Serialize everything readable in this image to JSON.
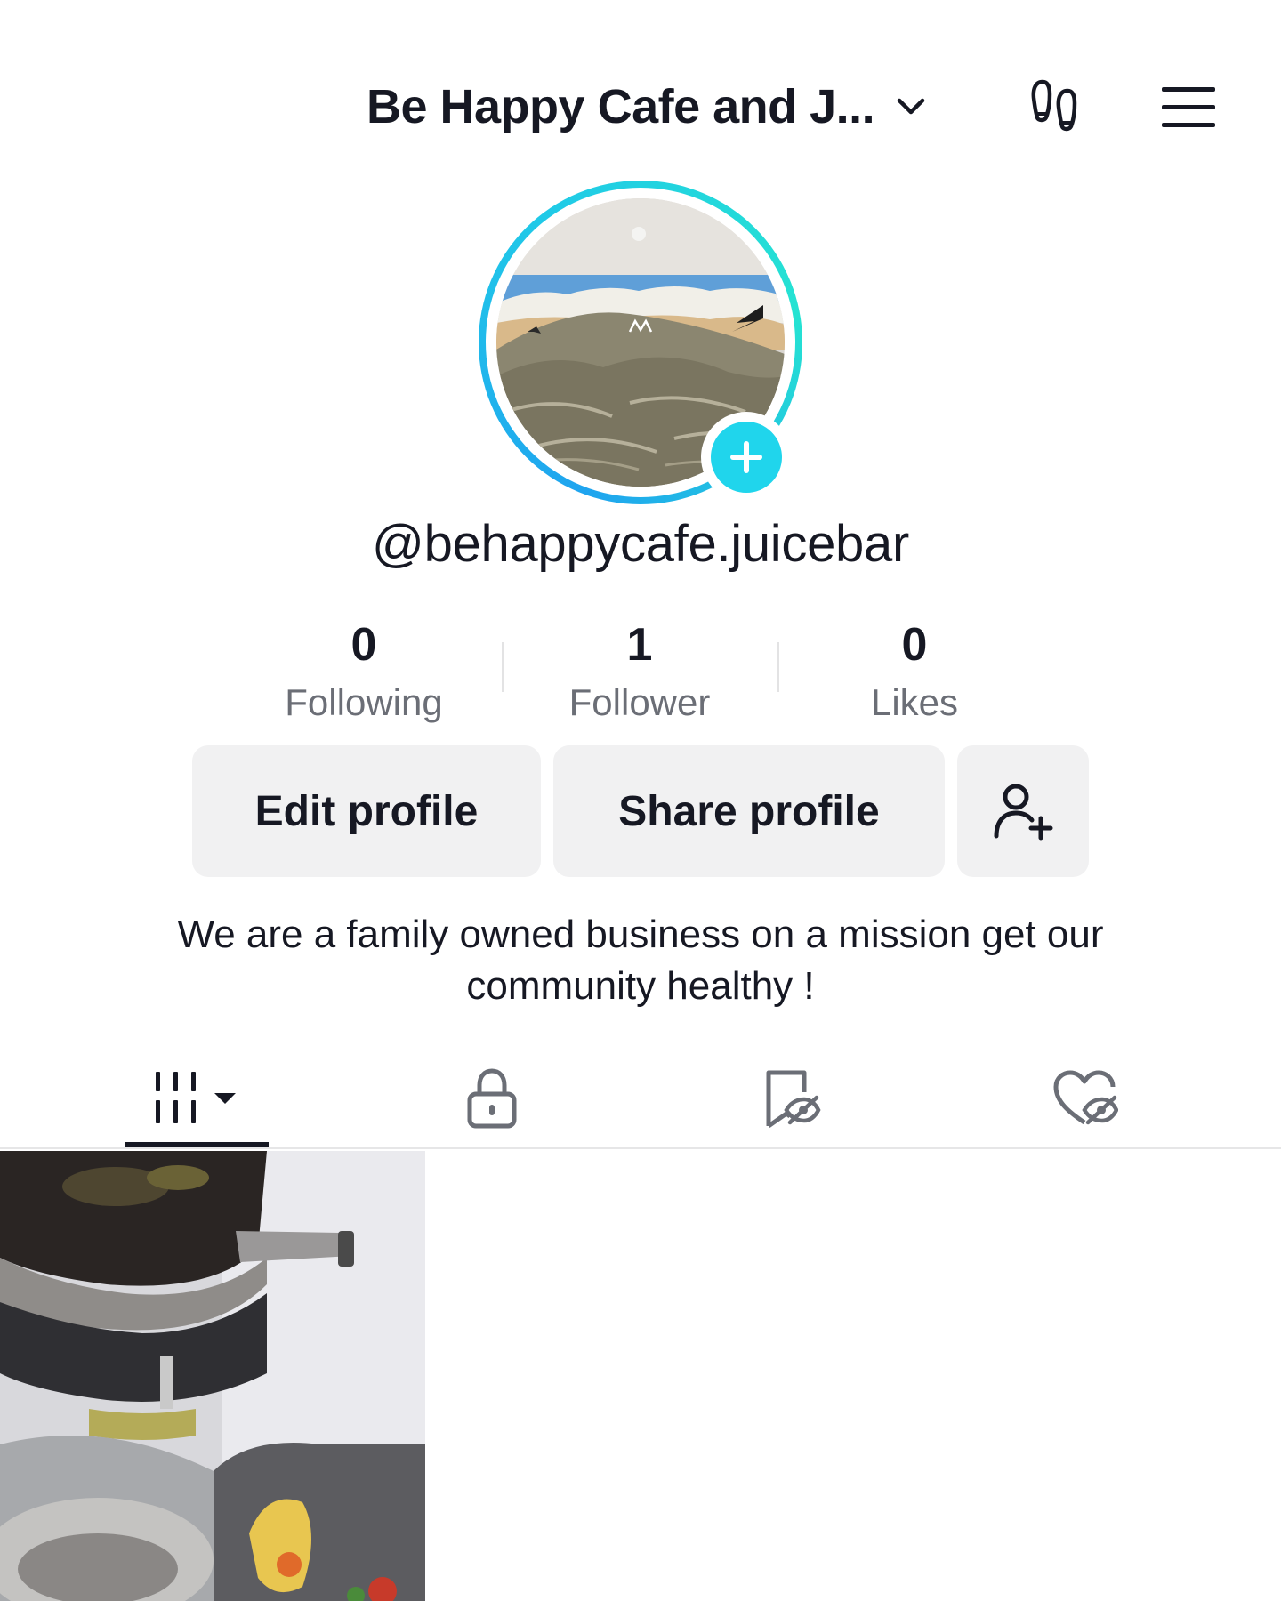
{
  "header": {
    "account_name": "Be Happy Cafe and J...",
    "icons": {
      "switch": "chevron-down-icon",
      "footprint": "footprint-icon",
      "menu": "hamburger-menu-icon"
    }
  },
  "profile": {
    "username": "@behappycafe.juicebar",
    "avatar_icon": "plus-icon",
    "stats": [
      {
        "value": "0",
        "label": "Following"
      },
      {
        "value": "1",
        "label": "Follower"
      },
      {
        "value": "0",
        "label": "Likes"
      }
    ],
    "buttons": {
      "edit": "Edit profile",
      "share": "Share profile",
      "add_friend_icon": "add-user-icon"
    },
    "bio": "We are a family owned business on a mission get our community healthy !"
  },
  "tabs": [
    {
      "icon": "video-grid-icon",
      "active": true
    },
    {
      "icon": "lock-icon",
      "active": false
    },
    {
      "icon": "hidden-bookmark-icon",
      "active": false
    },
    {
      "icon": "hidden-heart-icon",
      "active": false
    }
  ],
  "colors": {
    "text": "#161823",
    "secondary_text": "#6b6e76",
    "button_bg": "#f1f1f2",
    "accent_cyan": "#20d5ec",
    "ring_blue": "#1fa4ef"
  }
}
